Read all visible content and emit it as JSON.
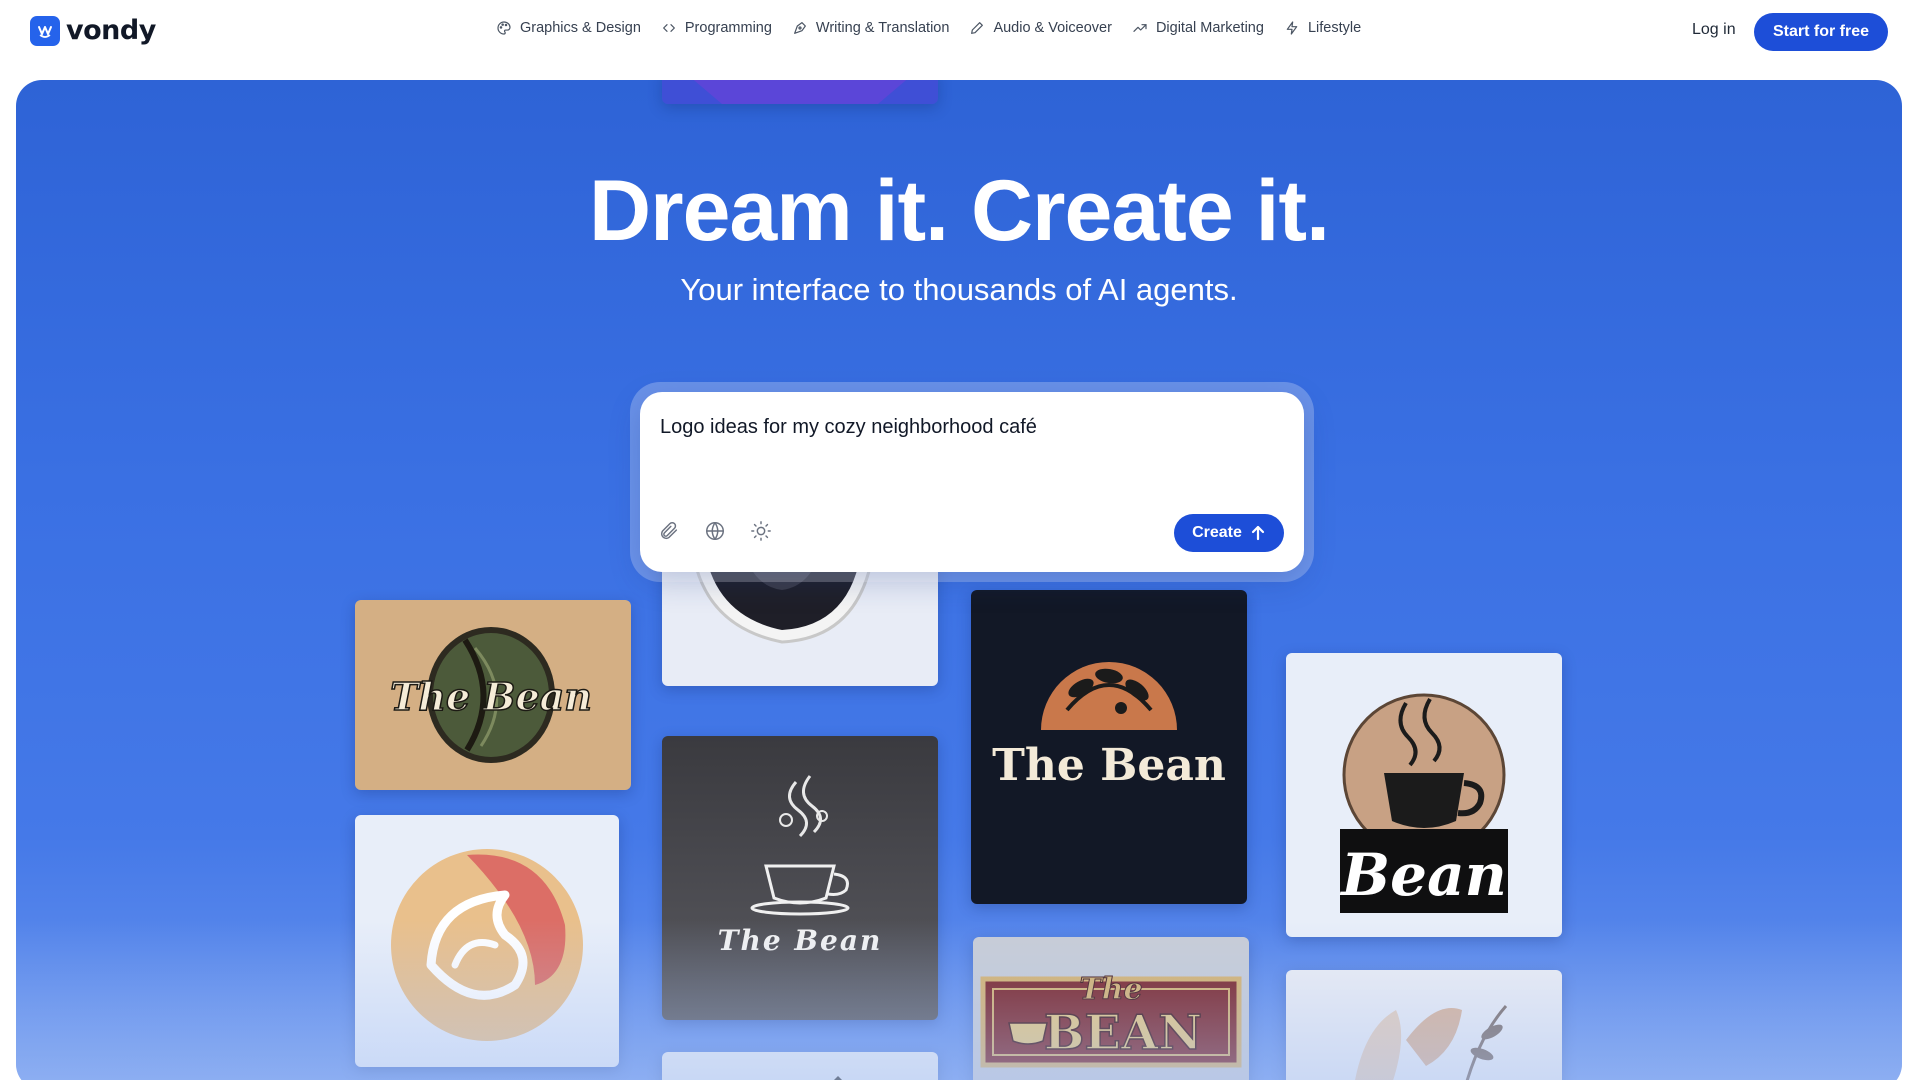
{
  "brand": {
    "name": "vondy",
    "accent": "#1d4ed8"
  },
  "nav": {
    "items": [
      {
        "label": "Graphics & Design",
        "icon": "palette-icon"
      },
      {
        "label": "Programming",
        "icon": "code-icon"
      },
      {
        "label": "Writing & Translation",
        "icon": "pen-nib-icon"
      },
      {
        "label": "Audio & Voiceover",
        "icon": "pencil-icon"
      },
      {
        "label": "Digital Marketing",
        "icon": "trending-up-icon"
      },
      {
        "label": "Lifestyle",
        "icon": "lightning-icon"
      }
    ]
  },
  "header": {
    "login_label": "Log in",
    "start_label": "Start for free"
  },
  "hero": {
    "title": "Dream it. Create it.",
    "subtitle": "Your interface to thousands of AI agents."
  },
  "prompt": {
    "value": "Logo ideas for my cozy neighborhood café",
    "tools": [
      "paperclip-icon",
      "globe-icon",
      "sun-icon"
    ],
    "create_label": "Create"
  },
  "gallery": {
    "bean_label": "The Bean",
    "bean_caps": "The Bean",
    "bean_short": "Bean",
    "sign_the": "The",
    "sign_bean": "BEAN"
  }
}
